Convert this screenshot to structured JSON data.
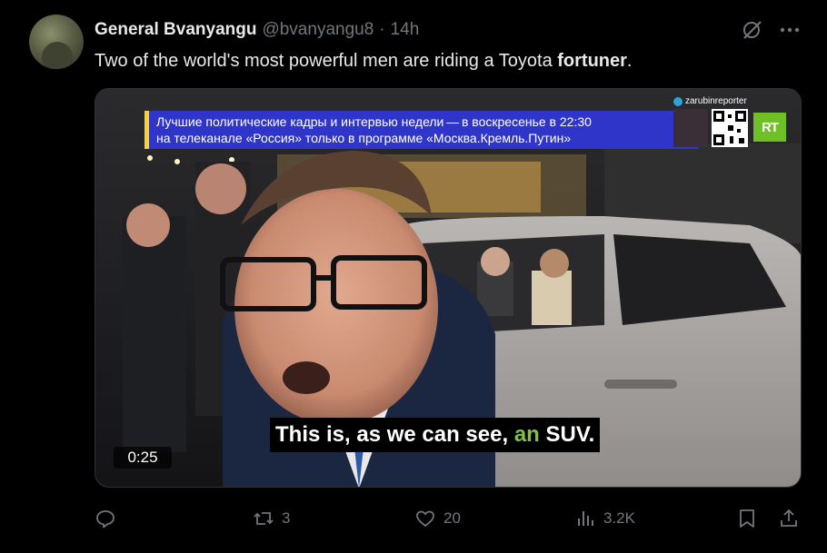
{
  "author": {
    "display_name": "General Bvanyangu",
    "handle": "@bvanyangu8",
    "separator": "·",
    "time": "14h"
  },
  "tweet": {
    "text_before": "Two of the world's most powerful men are riding a Toyota ",
    "text_bold": "fortuner",
    "text_after": "."
  },
  "video": {
    "banner_line1": "Лучшие политические кадры и интервью недели — в воскресенье в 22:30",
    "banner_line2": "на телеканале «Россия» только в программе «Москва.Кремль.Путин»",
    "telegram_label": "zarubinreporter",
    "channel_logo": "RT",
    "subtitle_before": "This is, as we can see, ",
    "subtitle_highlight": "an",
    "subtitle_after": " SUV.",
    "timestamp": "0:25",
    "colors": {
      "banner_bg": "#2e35c8",
      "banner_accent": "#ffd21f",
      "highlight": "#7fc242",
      "rt_green": "#6fbf26"
    }
  },
  "actions": {
    "reply_count": "",
    "retweet_count": "3",
    "like_count": "20",
    "views_count": "3.2K",
    "bookmark_count": "",
    "share_count": ""
  },
  "icons": [
    "grok-icon",
    "more-icon",
    "reply-icon",
    "retweet-icon",
    "like-icon",
    "views-icon",
    "bookmark-icon",
    "share-icon",
    "telegram-icon"
  ],
  "theme": {
    "background": "#000000",
    "text": "#e7e9ea",
    "muted": "#71767b"
  }
}
